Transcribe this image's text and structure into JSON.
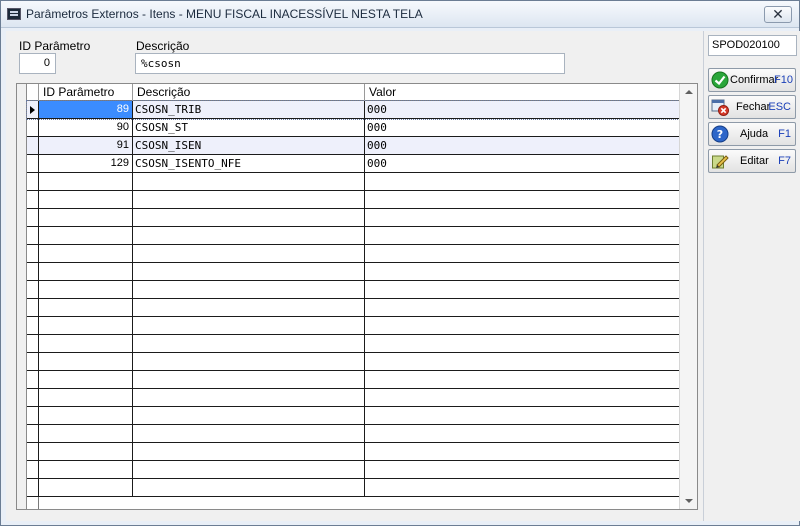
{
  "window": {
    "title": "Parâmetros Externos - Itens - MENU FISCAL INACESSÍVEL NESTA TELA",
    "close_glyph": "✕"
  },
  "filters": {
    "id_label": "ID Parâmetro",
    "id_value": "0",
    "desc_label": "Descrição",
    "desc_value": "%csosn"
  },
  "grid": {
    "columns": [
      "ID Parâmetro",
      "Descrição",
      "Valor"
    ],
    "rows": [
      {
        "id": "89",
        "descricao": "CSOSN_TRIB",
        "valor": "000"
      },
      {
        "id": "90",
        "descricao": "CSOSN_ST",
        "valor": "000"
      },
      {
        "id": "91",
        "descricao": "CSOSN_ISEN",
        "valor": "000"
      },
      {
        "id": "129",
        "descricao": "CSOSN_ISENTO_NFE",
        "valor": "000"
      }
    ],
    "empty_rows": 18,
    "selected_row": 0
  },
  "sidebar": {
    "code": "SPOD020100",
    "buttons": [
      {
        "label": "Confirmar",
        "key": "F10",
        "icon": "check-icon"
      },
      {
        "label": "Fechar",
        "key": "ESC",
        "icon": "close-form-icon"
      },
      {
        "label": "Ajuda",
        "key": "F1",
        "icon": "help-icon"
      },
      {
        "label": "Editar",
        "key": "F7",
        "icon": "edit-icon"
      }
    ]
  },
  "colors": {
    "selection": "#3b8cff",
    "alt_row": "#eef0fb",
    "key_text": "#1a3fb8"
  }
}
